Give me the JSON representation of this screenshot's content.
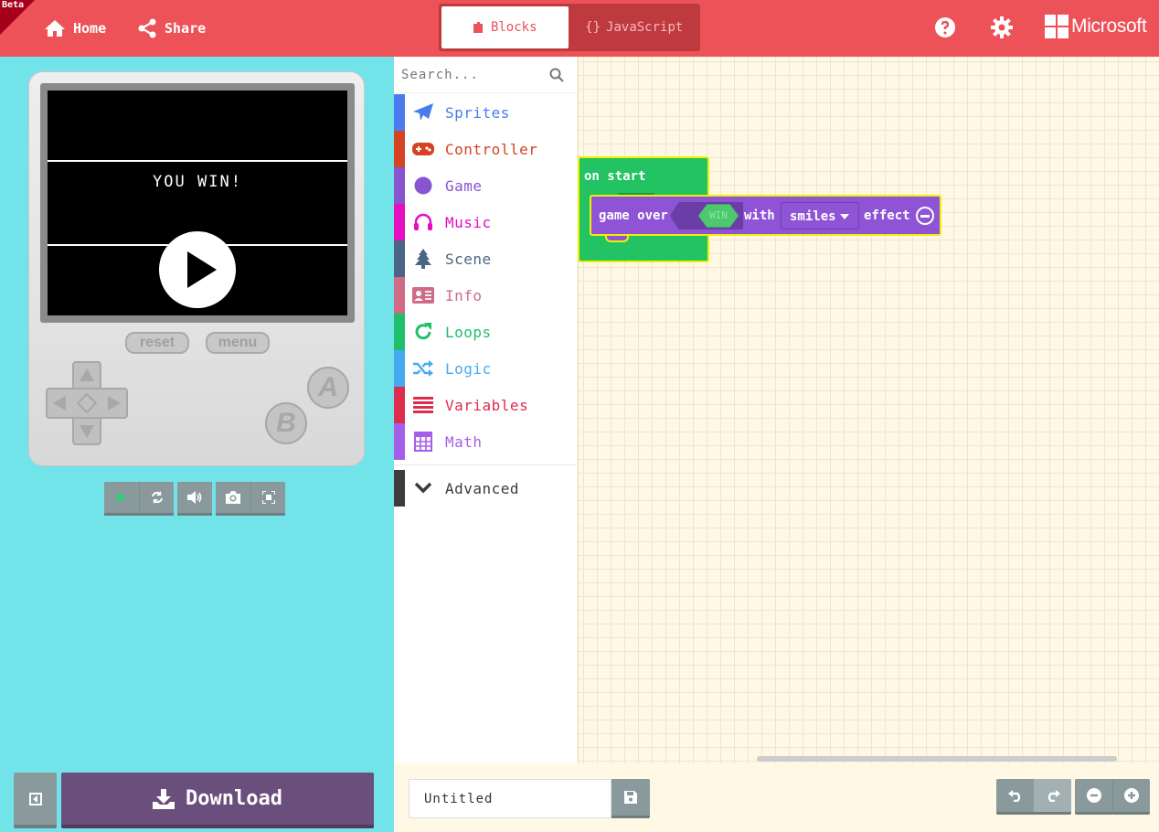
{
  "header": {
    "beta": "Beta",
    "home_label": "Home",
    "share_label": "Share",
    "blocks_tab": "Blocks",
    "javascript_tab": "JavaScript",
    "brand": "Microsoft"
  },
  "simulator": {
    "screen_text": "YOU WIN!",
    "reset_label": "reset",
    "menu_label": "menu",
    "a_label": "A",
    "b_label": "B"
  },
  "download_label": "Download",
  "search": {
    "placeholder": "Search..."
  },
  "toolbox": {
    "categories": [
      {
        "label": "Sprites",
        "color": "#4b7bec",
        "icon": "paper-plane-icon"
      },
      {
        "label": "Controller",
        "color": "#d54322",
        "icon": "gamepad-icon"
      },
      {
        "label": "Game",
        "color": "#8854d0",
        "icon": "circle-icon"
      },
      {
        "label": "Music",
        "color": "#e30fc0",
        "icon": "headphones-icon"
      },
      {
        "label": "Scene",
        "color": "#4b6584",
        "icon": "tree-icon"
      },
      {
        "label": "Info",
        "color": "#cf6a87",
        "icon": "id-card-icon"
      },
      {
        "label": "Loops",
        "color": "#20bf6b",
        "icon": "refresh-icon"
      },
      {
        "label": "Logic",
        "color": "#45aaf2",
        "icon": "shuffle-icon"
      },
      {
        "label": "Variables",
        "color": "#dd2c4d",
        "icon": "list-icon"
      },
      {
        "label": "Math",
        "color": "#a55eea",
        "icon": "calculator-icon"
      }
    ],
    "advanced_label": "Advanced"
  },
  "blocks": {
    "on_start": "on start",
    "game_over": "game over",
    "win_value": "WIN",
    "with": "with",
    "effect_value": "smiles",
    "effect": "effect"
  },
  "project_name": "Untitled",
  "colors": {
    "header": "#ec5257",
    "sim_bg": "#71e3e9",
    "download": "#6a4e7c",
    "workspace": "#fff8e5"
  }
}
